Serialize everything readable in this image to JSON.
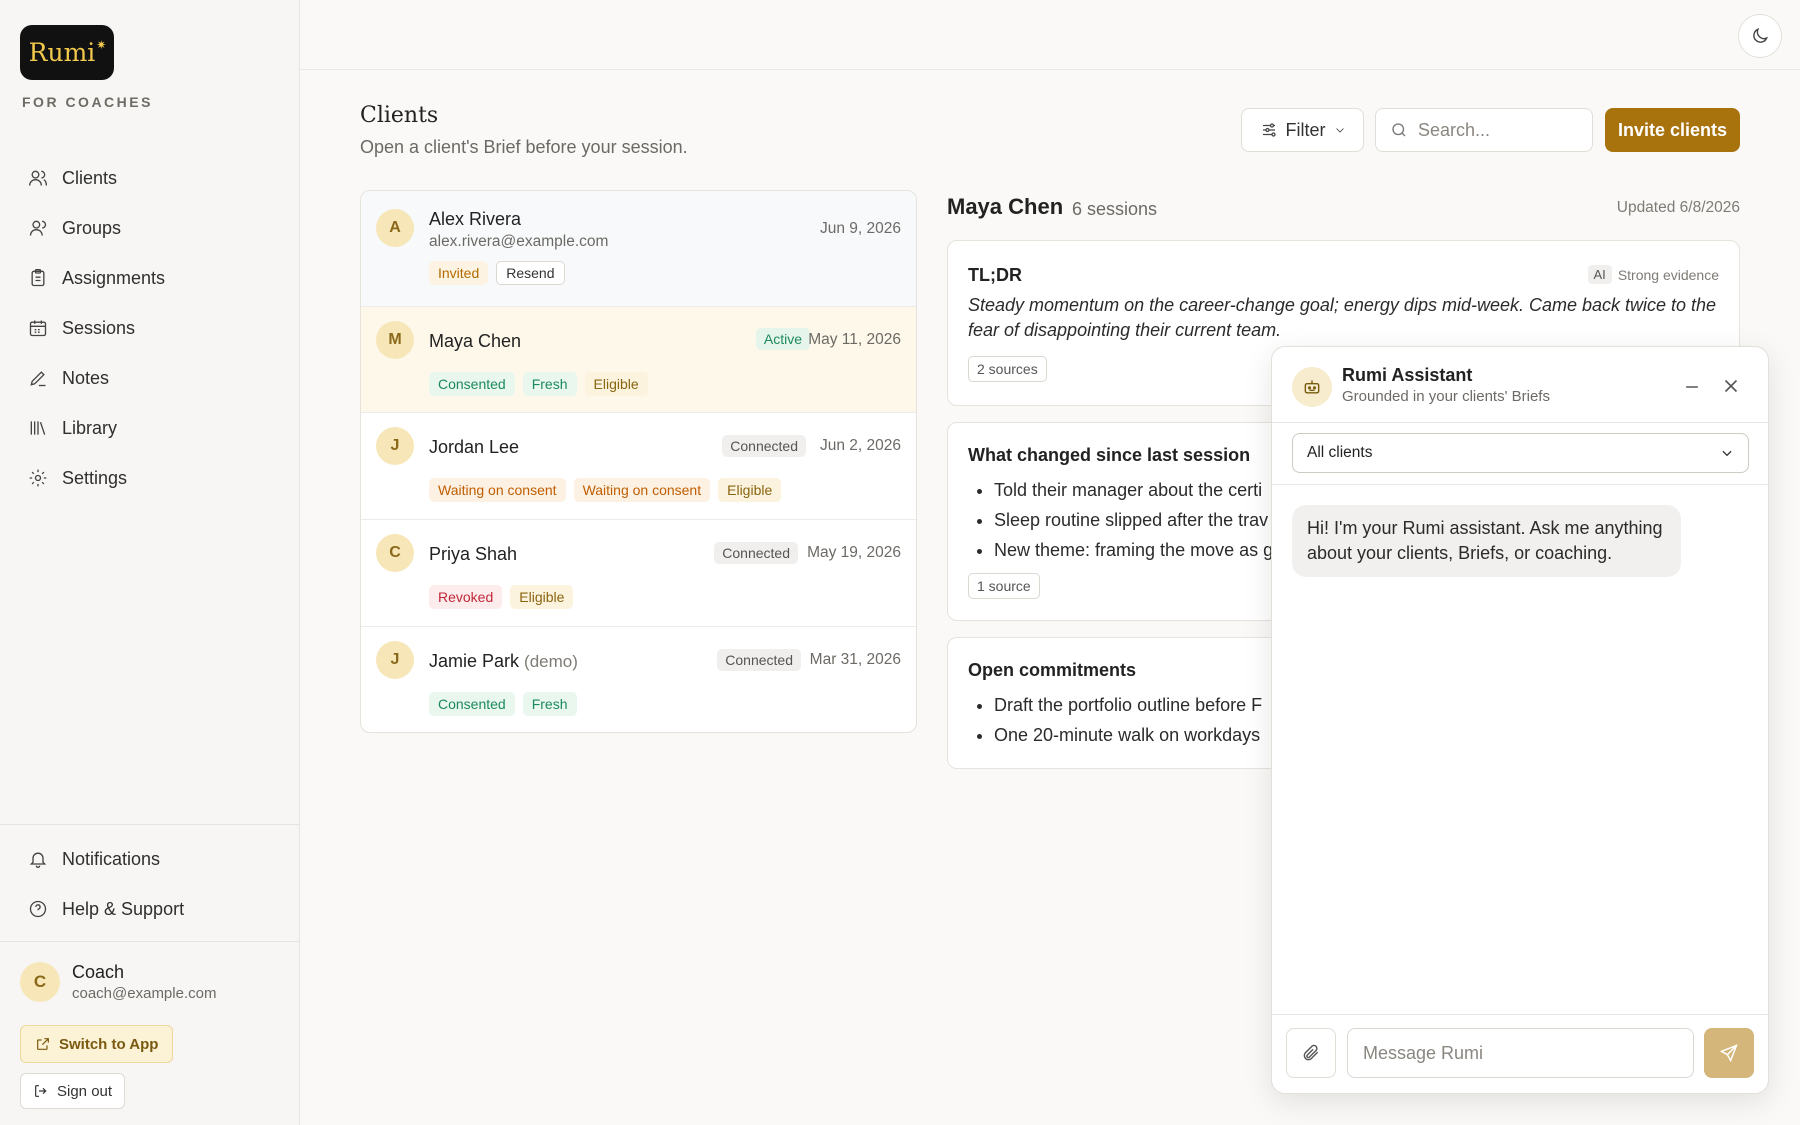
{
  "brand": {
    "logo_text": "Rumi",
    "subtitle": "FOR COACHES"
  },
  "sidebar": {
    "items": [
      {
        "label": "Clients",
        "icon": "users-icon"
      },
      {
        "label": "Groups",
        "icon": "groups-icon"
      },
      {
        "label": "Assignments",
        "icon": "clipboard-icon"
      },
      {
        "label": "Sessions",
        "icon": "calendar-icon"
      },
      {
        "label": "Notes",
        "icon": "pencil-icon"
      },
      {
        "label": "Library",
        "icon": "library-icon"
      },
      {
        "label": "Settings",
        "icon": "gear-icon"
      }
    ],
    "bottom_items": [
      {
        "label": "Notifications",
        "icon": "bell-icon"
      },
      {
        "label": "Help & Support",
        "icon": "help-icon"
      }
    ],
    "profile": {
      "initial": "C",
      "name": "Coach",
      "email": "coach@example.com"
    },
    "switch_label": "Switch to App",
    "signout_label": "Sign out"
  },
  "header": {
    "title": "Clients",
    "subtitle": "Open a client's Brief before your session.",
    "filter_label": "Filter",
    "search_placeholder": "Search...",
    "invite_label": "Invite clients"
  },
  "clients": [
    {
      "initial": "A",
      "name": "Alex Rivera",
      "email": "alex.rivera@example.com",
      "date": "Jun 9, 2026",
      "status": "",
      "tags": [
        "Invited",
        "Resend"
      ]
    },
    {
      "initial": "M",
      "name": "Maya Chen",
      "date": "May 11, 2026",
      "status": "Active",
      "tags": [
        "Consented",
        "Fresh",
        "Eligible"
      ]
    },
    {
      "initial": "J",
      "name": "Jordan Lee",
      "date": "Jun 2, 2026",
      "status": "Connected",
      "tags": [
        "Waiting on consent",
        "Waiting on consent",
        "Eligible"
      ]
    },
    {
      "initial": "C",
      "name": "Priya Shah",
      "date": "May 19, 2026",
      "status": "Connected",
      "tags": [
        "Revoked",
        "Eligible"
      ]
    },
    {
      "initial": "J",
      "name": "Jamie Park",
      "name_suffix": "(demo)",
      "date": "Mar 31, 2026",
      "status": "Connected",
      "tags": [
        "Consented",
        "Fresh"
      ]
    }
  ],
  "detail": {
    "name": "Maya Chen",
    "sessions": "6 sessions",
    "updated": "Updated 6/8/2026",
    "tldr": {
      "title": "TL;DR",
      "ai": "AI",
      "evidence": "Strong evidence",
      "text": "Steady momentum on the career-change goal; energy dips mid-week. Came back twice to the fear of disappointing their current team.",
      "sources": "2 sources"
    },
    "changed": {
      "title": "What changed since last session",
      "bullets": [
        "Told their manager about the certi",
        "Sleep routine slipped after the trav",
        "New theme: framing the move as g"
      ],
      "sources": "1 source"
    },
    "commitments": {
      "title": "Open commitments",
      "bullets": [
        "Draft the portfolio outline before F",
        "One 20-minute walk on workdays"
      ]
    }
  },
  "assistant": {
    "title": "Rumi Assistant",
    "subtitle": "Grounded in your clients' Briefs",
    "select_value": "All clients",
    "greeting": "Hi! I'm your Rumi assistant. Ask me anything about your clients, Briefs, or coaching.",
    "input_placeholder": "Message Rumi"
  }
}
